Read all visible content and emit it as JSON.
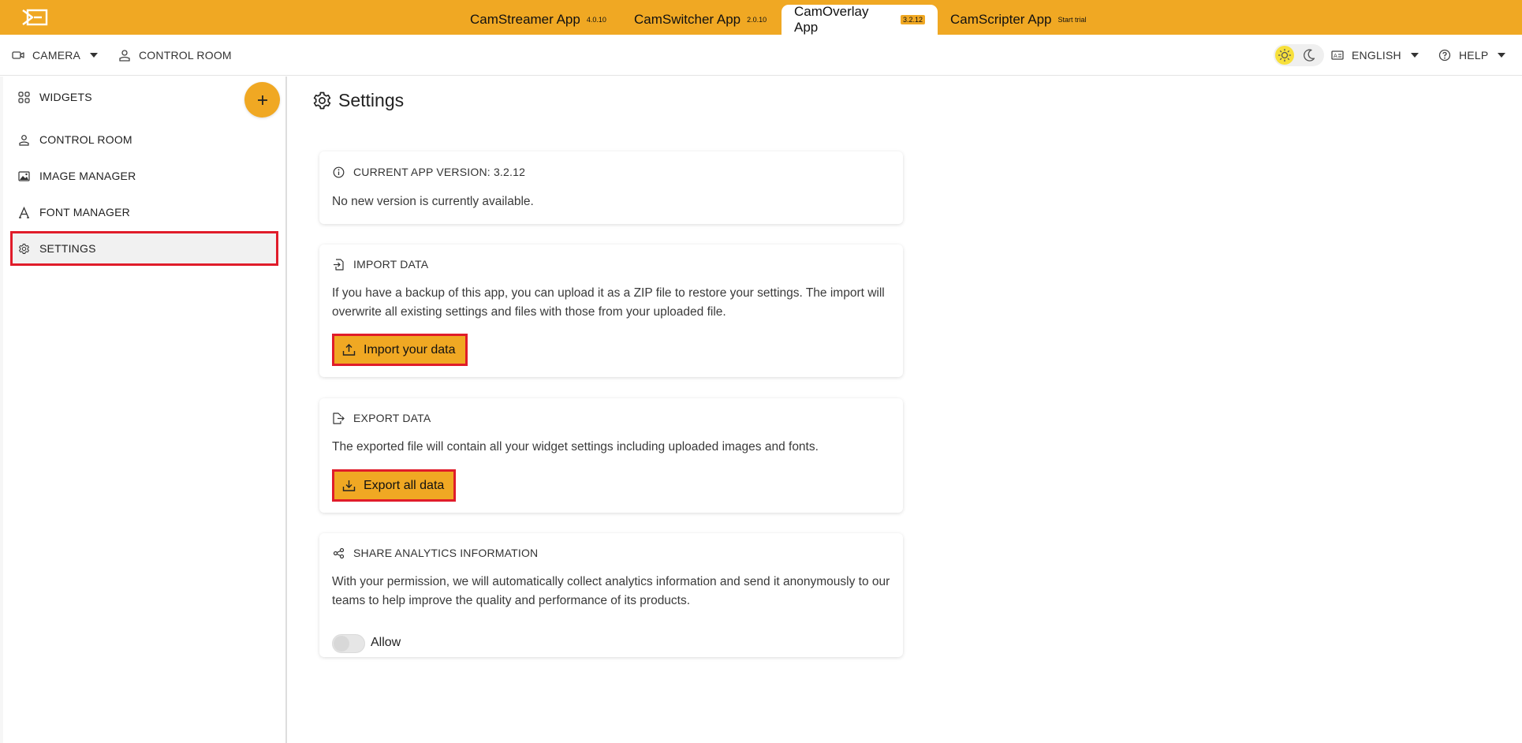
{
  "topbar": {
    "logo_icon": "camstreamer-logo-icon",
    "apps": [
      {
        "name": "CamStreamer App",
        "version": "4.0.10",
        "active": false
      },
      {
        "name": "CamSwitcher App",
        "version": "2.0.10",
        "active": false
      },
      {
        "name": "CamOverlay App",
        "version": "3.2.12",
        "active": true
      },
      {
        "name": "CamScripter App",
        "version": "Start trial",
        "active": false
      }
    ],
    "accent_color": "#f0a823"
  },
  "subbar": {
    "camera_label": "CAMERA",
    "control_room_label": "CONTROL ROOM",
    "language_label": "ENGLISH",
    "help_label": "HELP",
    "theme_options": [
      "sun-icon",
      "moon-icon"
    ]
  },
  "sidebar": {
    "items": [
      {
        "label": "WIDGETS",
        "icon": "widgets-icon"
      },
      {
        "label": "CONTROL ROOM",
        "icon": "person-icon"
      },
      {
        "label": "IMAGE MANAGER",
        "icon": "image-icon"
      },
      {
        "label": "FONT MANAGER",
        "icon": "font-icon"
      },
      {
        "label": "SETTINGS",
        "icon": "gear-icon",
        "active": true
      }
    ],
    "add_button": "+"
  },
  "main": {
    "title": "Settings",
    "version_card": {
      "heading": "CURRENT APP VERSION: 3.2.12",
      "text": "No new version is currently available."
    },
    "import_card": {
      "heading": "IMPORT DATA",
      "text": "If you have a backup of this app, you can upload it as a ZIP file to restore your settings. The import will overwrite all existing settings and files with those from your uploaded file.",
      "button": "Import your data"
    },
    "export_card": {
      "heading": "EXPORT DATA",
      "text": "The exported file will contain all your widget settings including uploaded images and fonts.",
      "button": "Export all data"
    },
    "analytics_card": {
      "heading": "SHARE ANALYTICS INFORMATION",
      "text": "With your permission, we will automatically collect analytics information and send it anonymously to our teams to help improve the quality and performance of its products.",
      "toggle_label": "Allow",
      "toggle_on": false
    }
  },
  "highlight_color": "#e01c2a"
}
